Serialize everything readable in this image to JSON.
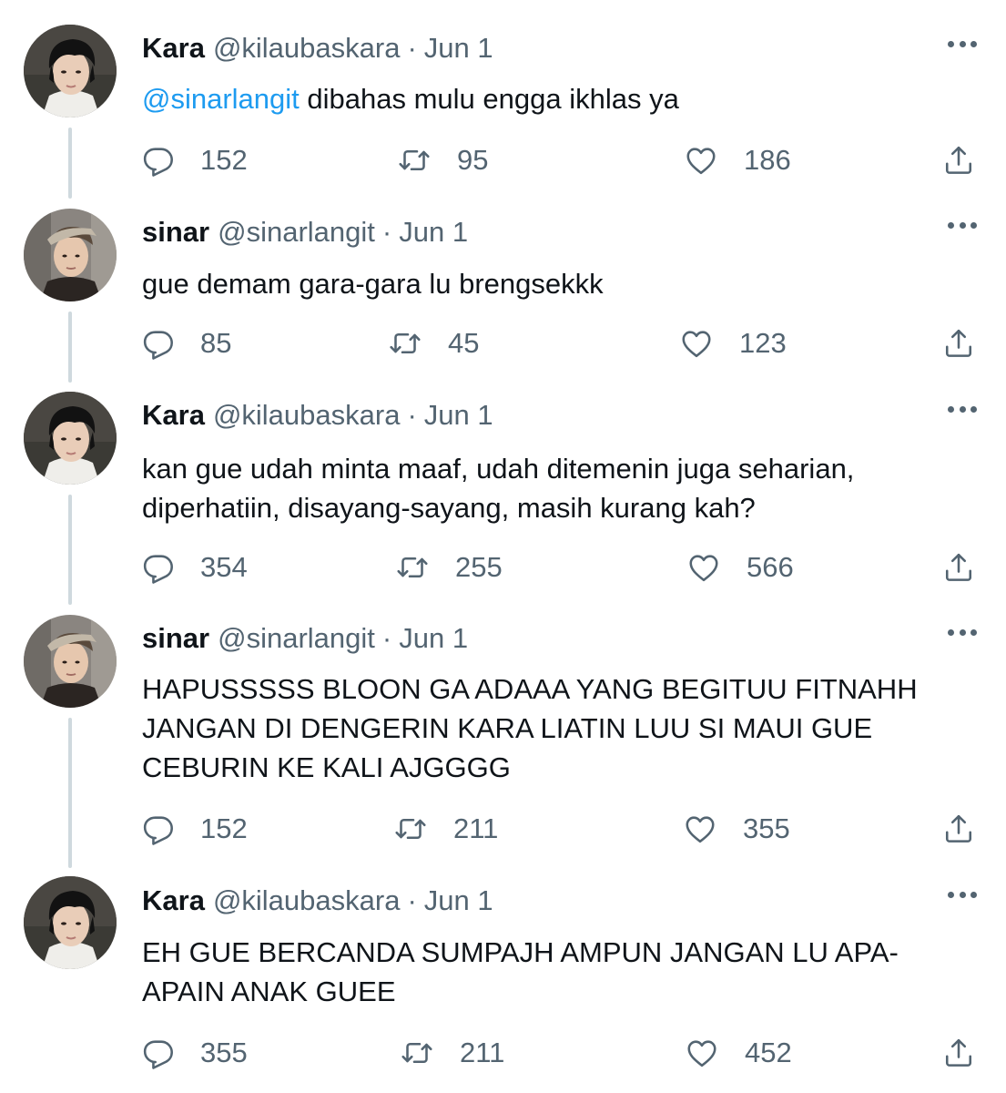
{
  "tweets": [
    {
      "name": "Kara",
      "handle": "@kilaubaskara",
      "dot": "·",
      "date": "Jun 1",
      "mention": "@sinarlangit",
      "text": " dibahas mulu engga ikhlas ya",
      "replies": "152",
      "retweets": "95",
      "likes": "186"
    },
    {
      "name": "sinar",
      "handle": "@sinarlangit",
      "dot": "·",
      "date": "Jun 1",
      "text": "gue demam gara-gara lu brengsekkk",
      "replies": "85",
      "retweets": "45",
      "likes": "123"
    },
    {
      "name": "Kara",
      "handle": "@kilaubaskara",
      "dot": "·",
      "date": "Jun 1",
      "text": "kan gue udah minta maaf, udah ditemenin juga seharian,\ndiperhatiin, disayang-sayang, masih kurang kah?",
      "replies": "354",
      "retweets": "255",
      "likes": "566"
    },
    {
      "name": "sinar",
      "handle": "@sinarlangit",
      "dot": "·",
      "date": "Jun 1",
      "text": "HAPUSSSSS BLOON GA ADAAA YANG BEGITUU FITNAHH\nJANGAN DI DENGERIN KARA LIATIN LUU SI MAUI GUE\nCEBURIN KE KALI AJGGGG",
      "replies": "152",
      "retweets": "211",
      "likes": "355"
    },
    {
      "name": "Kara",
      "handle": "@kilaubaskara",
      "dot": "·",
      "date": "Jun 1",
      "text": "EH GUE BERCANDA SUMPAJH AMPUN JANGAN LU APA-\nAPAIN ANAK GUEE",
      "replies": "355",
      "retweets": "211",
      "likes": "452"
    }
  ],
  "colors": {
    "text": "#0f1419",
    "secondary": "#536471",
    "link": "#1d9bf0",
    "thread_line": "#cfd9de"
  },
  "icons": {
    "more": "more-icon",
    "reply": "reply-icon",
    "retweet": "retweet-icon",
    "like": "like-icon",
    "share": "share-icon"
  }
}
